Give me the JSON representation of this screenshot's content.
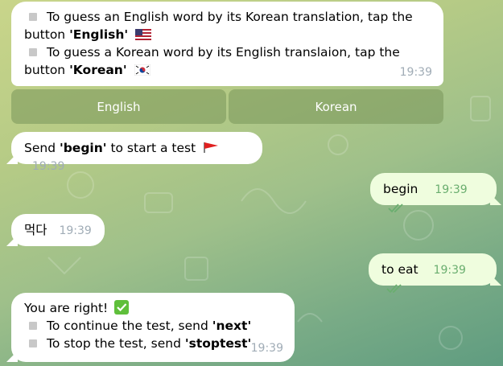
{
  "msg1": {
    "line1_text": "To guess an English word by its Korean translation, tap the",
    "line1b_prefix": "button ",
    "line1b_bold": "'English'",
    "line2_text": "To guess a Korean word by its English translaion, tap the",
    "line2b_prefix": "button ",
    "line2b_bold": "'Korean'",
    "time": "19:39"
  },
  "keyboard": {
    "english_label": "English",
    "korean_label": "Korean"
  },
  "msg2": {
    "prefix": "Send ",
    "bold": "'begin'",
    "suffix": " to start a test",
    "time": "19:39"
  },
  "msg3": {
    "text": "begin",
    "time": "19:39"
  },
  "msg4": {
    "text": "먹다",
    "time": "19:39"
  },
  "msg5": {
    "text": "to eat",
    "time": "19:39"
  },
  "msg6": {
    "line1": "You are right!",
    "line2_prefix": "To continue the test, send ",
    "line2_bold": "'next'",
    "line3_prefix": "To stop the test, send ",
    "line3_bold": "'stoptest'",
    "time": "19:39"
  },
  "colors": {
    "accent_out_bubble": "#effdde",
    "read_ticks": "#6aae6f",
    "timestamp": "#a0acb6"
  },
  "icons": [
    "us-flag-icon",
    "korea-flag-icon",
    "red-flag-icon",
    "double-check-icon",
    "check-mark-button-icon",
    "square-bullet-icon"
  ]
}
